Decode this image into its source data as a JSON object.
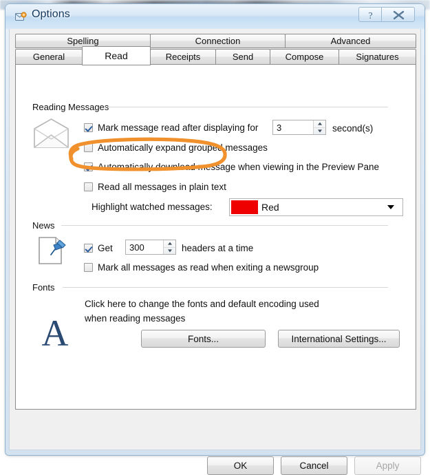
{
  "window": {
    "title": "Options",
    "icon": "mail-options-icon",
    "help_button": "?",
    "close_button": "X"
  },
  "tabs": {
    "row1": [
      {
        "label": "Spelling",
        "selected": false
      },
      {
        "label": "Connection",
        "selected": false
      },
      {
        "label": "Advanced",
        "selected": false
      }
    ],
    "row2": [
      {
        "label": "General",
        "selected": false
      },
      {
        "label": "Read",
        "selected": true
      },
      {
        "label": "Receipts",
        "selected": false
      },
      {
        "label": "Send",
        "selected": false
      },
      {
        "label": "Compose",
        "selected": false
      },
      {
        "label": "Signatures",
        "selected": false
      }
    ]
  },
  "reading_messages": {
    "group_label": "Reading Messages",
    "icon": "open-envelope-icon",
    "mark_read": {
      "label": "Mark message read after displaying for",
      "checked": true,
      "value": "3",
      "suffix": "second(s)"
    },
    "expand_grouped": {
      "label": "Automatically expand grouped messages",
      "checked": false
    },
    "auto_download": {
      "label": "Automatically download message when viewing in the Preview Pane",
      "checked": true
    },
    "plain_text": {
      "label": "Read all messages in plain text",
      "checked": false
    },
    "highlight": {
      "label": "Highlight watched messages:",
      "value": "Red",
      "swatch_color": "#EE0000"
    }
  },
  "news": {
    "group_label": "News",
    "icon": "page-pushpin-icon",
    "get_headers": {
      "label": "Get",
      "checked": true,
      "value": "300",
      "suffix": "headers at a time"
    },
    "mark_read_on_exit": {
      "label": "Mark all messages as read when exiting a newsgroup",
      "checked": false
    }
  },
  "fonts": {
    "group_label": "Fonts",
    "icon": "letter-a-icon",
    "description_line1": "Click here to change the fonts and default encoding used",
    "description_line2": "when reading messages",
    "fonts_button": "Fonts...",
    "international_button": "International Settings..."
  },
  "footer": {
    "ok": "OK",
    "cancel": "Cancel",
    "apply": "Apply",
    "apply_disabled": true
  },
  "annotation": {
    "shape": "hand-drawn-ellipse",
    "color": "#F0912D",
    "target": "Read all messages in plain text"
  }
}
